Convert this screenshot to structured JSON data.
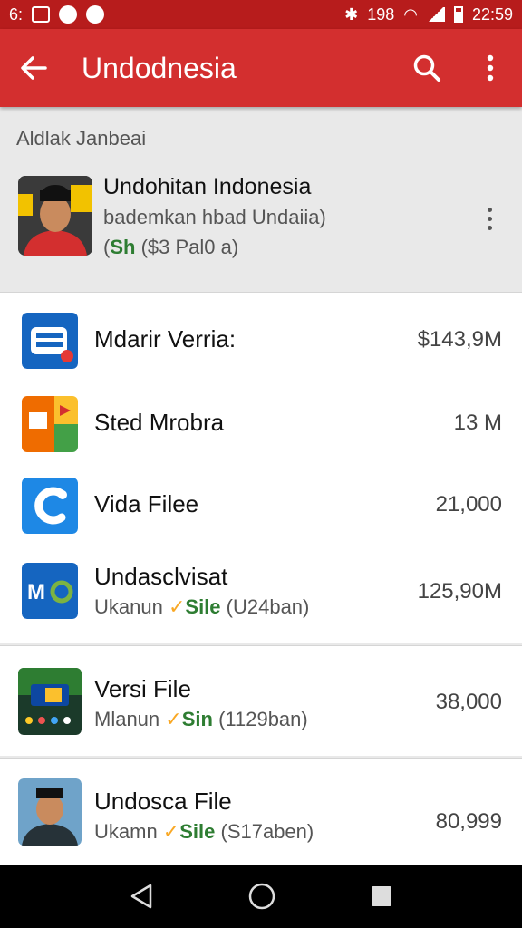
{
  "status": {
    "left_text": "6:",
    "right_text": "198",
    "time": "22:59"
  },
  "app_bar": {
    "title": "Undodnesia"
  },
  "section_header": "Aldlak Janbeai",
  "featured": {
    "title": "Undohitan Indonesia",
    "subtitle": "bademkan hbad Undaiia)",
    "meta_prefix": "(",
    "meta_green": "Sh",
    "meta_suffix": " ($3 Pal0 a)"
  },
  "items": [
    {
      "name": "Mdarir Verria:",
      "value": "$143,9M",
      "icon": "e-app-icon",
      "color": "#1565c0"
    },
    {
      "name": "Sted Mrobra",
      "value": "13 M",
      "icon": "slides-app-icon",
      "color": "#ef6c00"
    },
    {
      "name": "Vida Filee",
      "value": "21,000",
      "icon": "c-app-icon",
      "color": "#1e88e5"
    },
    {
      "name": "Undasclvisat",
      "sub_prefix": "Ukanun ",
      "sub_check": "✓",
      "sub_green": "Sile",
      "sub_suffix": " (U24ban)",
      "value": "125,90M",
      "icon": "mb-app-icon",
      "color": "#1565c0"
    },
    {
      "name": "Versi File",
      "sub_prefix": "Mlanun ",
      "sub_check": "✓",
      "sub_green": "Sin",
      "sub_suffix": " (1129ban)",
      "value": "38,000",
      "icon": "video-thumbnail-icon",
      "color": "#2e7d32"
    },
    {
      "name": "Undosca File",
      "sub_prefix": "Ukamn ",
      "sub_check": "✓",
      "sub_green": "Sile",
      "sub_suffix": " (S17aben)",
      "value": "80,999",
      "icon": "person-avatar-icon",
      "color": "#3e5a3a"
    }
  ],
  "colors": {
    "status_bar": "#b71c1c",
    "app_bar": "#d32f2f",
    "accent_green": "#2e7d32",
    "check_yellow": "#f9a825"
  },
  "icons": [
    "back-arrow-icon",
    "search-icon",
    "more-vert-icon",
    "nav-back-icon",
    "nav-home-icon",
    "nav-recents-icon"
  ]
}
